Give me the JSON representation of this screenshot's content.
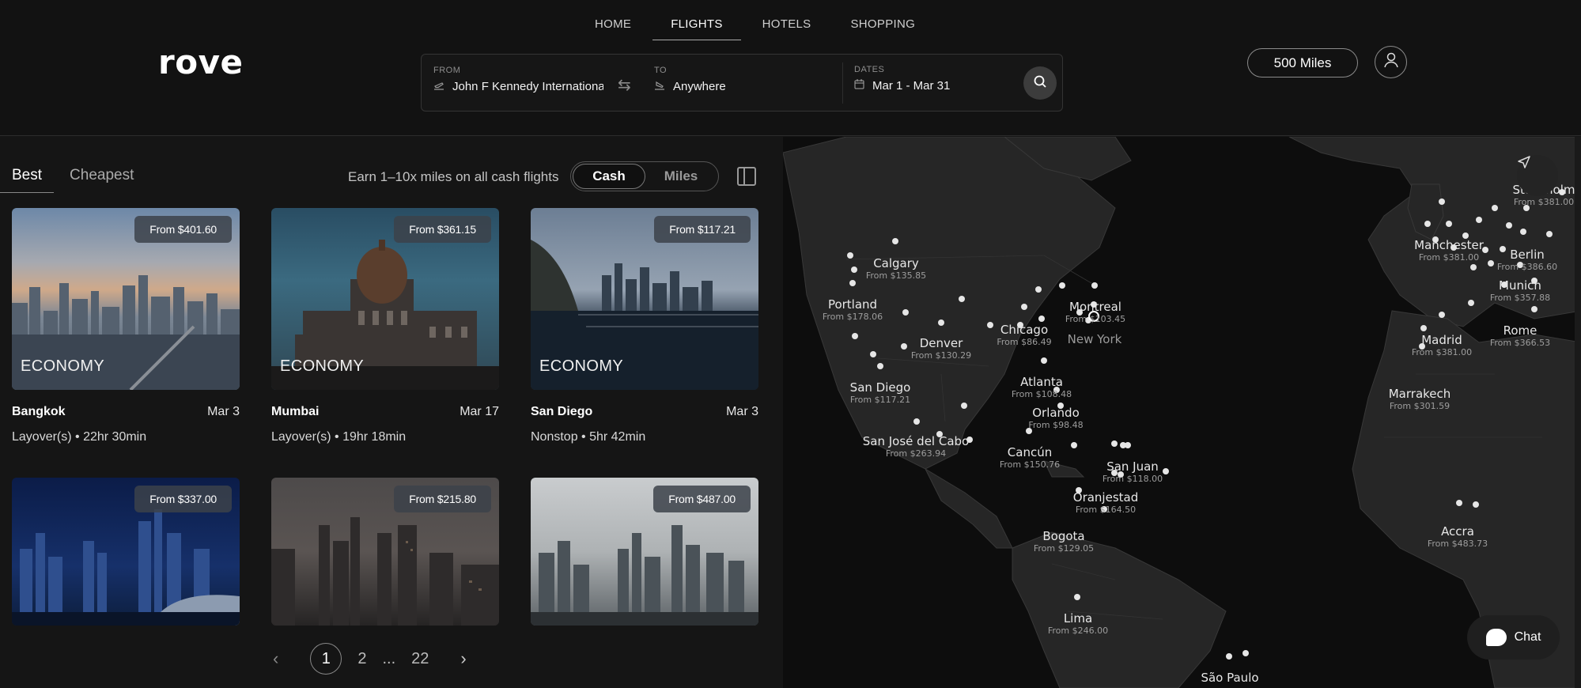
{
  "brand": {
    "logo": "rove"
  },
  "nav": {
    "items": [
      "HOME",
      "FLIGHTS",
      "HOTELS",
      "SHOPPING"
    ],
    "active": "FLIGHTS"
  },
  "search": {
    "from_label": "FROM",
    "from_value": "John F Kennedy Internationa",
    "to_label": "TO",
    "to_value": "Anywhere",
    "dates_label": "DATES",
    "dates_value": "Mar 1 - Mar 31"
  },
  "account": {
    "miles": "500 Miles"
  },
  "results": {
    "tabs": [
      "Best",
      "Cheapest"
    ],
    "earn_text": "Earn 1–10x miles on all cash flights",
    "toggle": [
      "Cash",
      "Miles"
    ],
    "cards": [
      {
        "city": "Bangkok",
        "date": "Mar 3",
        "meta": "Layover(s) • 22hr 30min",
        "price": "From $401.60",
        "cabin": "ECONOMY"
      },
      {
        "city": "Mumbai",
        "date": "Mar 17",
        "meta": "Layover(s) • 19hr 18min",
        "price": "From $361.15",
        "cabin": "ECONOMY"
      },
      {
        "city": "San Diego",
        "date": "Mar 3",
        "meta": "Nonstop • 5hr 42min",
        "price": "From $117.21",
        "cabin": "ECONOMY"
      },
      {
        "price": "From $337.00"
      },
      {
        "price": "From $215.80"
      },
      {
        "price": "From $487.00"
      }
    ],
    "pagination": {
      "pages": [
        "1",
        "2",
        "...",
        "22"
      ],
      "current": "1"
    }
  },
  "map": {
    "labels": [
      {
        "city": "Calgary",
        "price": "From $135.85"
      },
      {
        "city": "Portland",
        "price": "From $178.06"
      },
      {
        "city": "Denver",
        "price": "From $130.29"
      },
      {
        "city": "Chicago",
        "price": "From $86.49"
      },
      {
        "city": "Montreal",
        "price": "From $103.45"
      },
      {
        "city": "New York",
        "price": ""
      },
      {
        "city": "San Diego",
        "price": "From $117.21"
      },
      {
        "city": "Atlanta",
        "price": "From $108.48"
      },
      {
        "city": "Orlando",
        "price": "From $98.48"
      },
      {
        "city": "San José del Cabo",
        "price": "From $263.94"
      },
      {
        "city": "Cancún",
        "price": "From $150.76"
      },
      {
        "city": "San Juan",
        "price": "From $118.00"
      },
      {
        "city": "Oranjestad",
        "price": "From $164.50"
      },
      {
        "city": "Bogota",
        "price": "From $129.05"
      },
      {
        "city": "Lima",
        "price": "From $246.00"
      },
      {
        "city": "São Paulo",
        "price": ""
      },
      {
        "city": "Manchester",
        "price": "From $381.00"
      },
      {
        "city": "Berlin",
        "price": "From $386.60"
      },
      {
        "city": "Munich",
        "price": "From $357.88"
      },
      {
        "city": "Madrid",
        "price": "From $381.00"
      },
      {
        "city": "Rome",
        "price": "From $366.53"
      },
      {
        "city": "Marrakech",
        "price": "From $301.59"
      },
      {
        "city": "Accra",
        "price": "From $483.73"
      },
      {
        "city": "Stockholm",
        "price": "From $381.00"
      }
    ],
    "chat_label": "Chat"
  }
}
